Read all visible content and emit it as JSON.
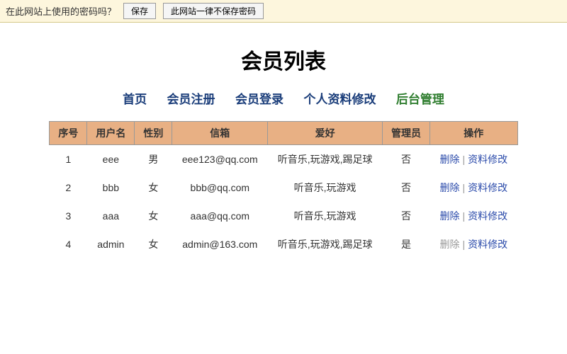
{
  "notify": {
    "prompt": "在此网站上使用的密码吗？",
    "save_btn": "保存",
    "never_btn": "此网站一律不保存密码"
  },
  "page_title": "会员列表",
  "nav": {
    "home": "首页",
    "register": "会员注册",
    "login": "会员登录",
    "profile": "个人资料修改",
    "admin": "后台管理"
  },
  "table": {
    "headers": {
      "seq": "序号",
      "username": "用户名",
      "gender": "性别",
      "email": "信箱",
      "hobby": "爱好",
      "admin": "管理员",
      "actions": "操作"
    },
    "action_labels": {
      "delete": "删除",
      "edit": "资料修改",
      "sep": "|"
    },
    "rows": [
      {
        "seq": "1",
        "username": "eee",
        "gender": "男",
        "email": "eee123@qq.com",
        "hobby": "听音乐,玩游戏,踢足球",
        "admin": "否",
        "delete_disabled": false
      },
      {
        "seq": "2",
        "username": "bbb",
        "gender": "女",
        "email": "bbb@qq.com",
        "hobby": "听音乐,玩游戏",
        "admin": "否",
        "delete_disabled": false
      },
      {
        "seq": "3",
        "username": "aaa",
        "gender": "女",
        "email": "aaa@qq.com",
        "hobby": "听音乐,玩游戏",
        "admin": "否",
        "delete_disabled": false
      },
      {
        "seq": "4",
        "username": "admin",
        "gender": "女",
        "email": "admin@163.com",
        "hobby": "听音乐,玩游戏,踢足球",
        "admin": "是",
        "delete_disabled": true
      }
    ]
  }
}
